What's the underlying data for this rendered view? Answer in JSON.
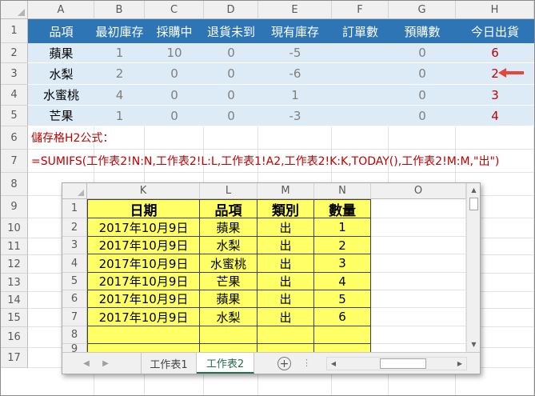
{
  "sheet": {
    "columns": [
      "A",
      "B",
      "C",
      "D",
      "E",
      "F",
      "G",
      "H"
    ],
    "rows": [
      "1",
      "2",
      "3",
      "4",
      "5",
      "6",
      "7",
      "8",
      "9",
      "10",
      "11",
      "12",
      "13",
      "14",
      "15",
      "16",
      "17"
    ],
    "header": [
      "品項",
      "最初庫存",
      "採購中",
      "退貨未到",
      "現有庫存",
      "訂單數",
      "預購數",
      "今日出貨"
    ],
    "data": [
      [
        "蘋果",
        "1",
        "10",
        "0",
        "-5",
        "",
        "0",
        "6"
      ],
      [
        "水梨",
        "2",
        "0",
        "0",
        "-6",
        "",
        "0",
        "2"
      ],
      [
        "水蜜桃",
        "4",
        "0",
        "0",
        "1",
        "",
        "0",
        "3"
      ],
      [
        "芒果",
        "1",
        "0",
        "0",
        "-3",
        "",
        "0",
        "4"
      ]
    ],
    "note_label": "儲存格H2公式：",
    "formula": "=SUMIFS(工作表2!N:N,工作表2!L:L,工作表1!A2,工作表2!K:K,TODAY(),工作表2!M:M,\"出\")"
  },
  "window": {
    "columns": [
      "K",
      "L",
      "M",
      "N",
      "O"
    ],
    "rows": [
      "1",
      "2",
      "3",
      "4",
      "5",
      "6",
      "7",
      "8",
      "9"
    ],
    "header": [
      "日期",
      "品項",
      "類別",
      "數量"
    ],
    "data": [
      [
        "2017年10月9日",
        "蘋果",
        "出",
        "1"
      ],
      [
        "2017年10月9日",
        "水梨",
        "出",
        "2"
      ],
      [
        "2017年10月9日",
        "水蜜桃",
        "出",
        "3"
      ],
      [
        "2017年10月9日",
        "芒果",
        "出",
        "4"
      ],
      [
        "2017年10月9日",
        "蘋果",
        "出",
        "5"
      ],
      [
        "2017年10月9日",
        "水梨",
        "出",
        "6"
      ]
    ],
    "tabs": [
      "工作表1",
      "工作表2"
    ],
    "active_tab": "工作表2",
    "add_sheet_symbol": "+",
    "more_symbol": "⋮"
  },
  "colors": {
    "header_blue": "#2e75b6",
    "row_fill": "#ddebf7",
    "red_text": "#c00000",
    "arrow": "#e8453c",
    "cell_yellow": "#ffff66",
    "active_tab": "#217346"
  },
  "icons": {
    "arrow": "left-arrow-icon",
    "tab_prev": "chevron-left-icon",
    "tab_next": "chevron-right-icon",
    "add_sheet": "plus-circle-icon"
  }
}
